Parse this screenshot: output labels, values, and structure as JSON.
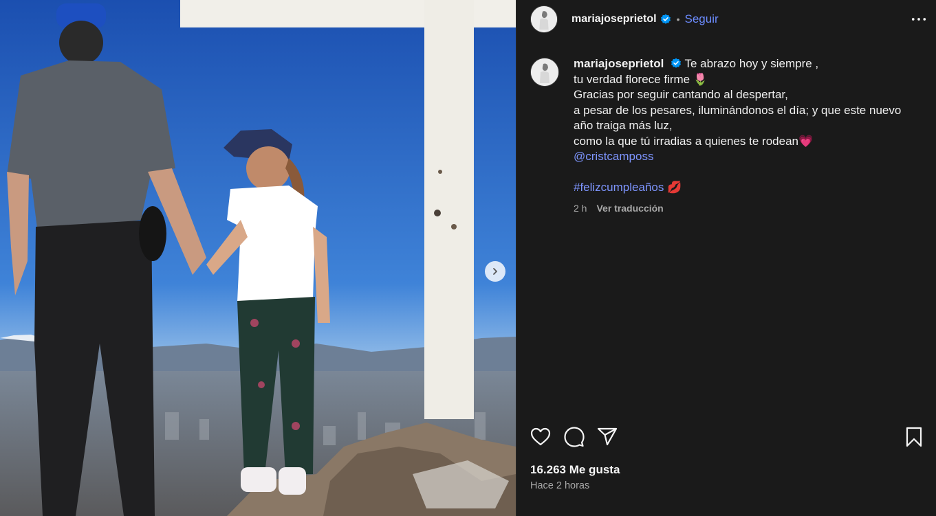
{
  "post": {
    "username": "mariajoseprietol",
    "follow_label": "Seguir",
    "separator": "•",
    "caption": {
      "username": "mariajoseprietol",
      "lines": [
        "Te abrazo hoy y siempre ,",
        "tu verdad florece firme 🌷",
        "Gracias por seguir cantando al despertar,",
        "a pesar de los pesares, iluminándonos el día; y que este nuevo",
        "año traiga más luz,",
        "como la que tú irradias a quienes te rodean💗"
      ],
      "mention": "@cristcamposs",
      "hashtag": "#felizcumpleaños",
      "hashtag_emoji": "💋",
      "time_ago": "2 h",
      "translate_label": "Ver traducción"
    },
    "likes_label": "16.263 Me gusta",
    "timestamp": "Hace 2 horas",
    "icons": {
      "verified": "verified-badge-icon",
      "more": "more-options-icon",
      "like": "heart-icon",
      "comment": "comment-icon",
      "share": "share-icon",
      "save": "bookmark-icon",
      "next": "chevron-right-icon"
    },
    "colors": {
      "accent": "#0095f6",
      "link": "#7e95ff",
      "background": "#000000"
    }
  }
}
